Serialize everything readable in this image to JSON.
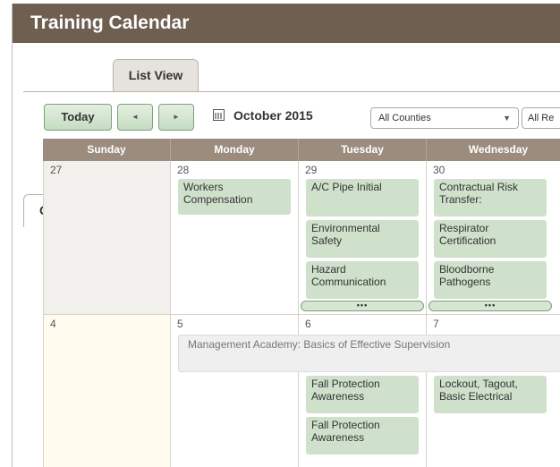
{
  "app": {
    "title": "Training Calendar"
  },
  "tabs": [
    {
      "label": "Calendar"
    },
    {
      "label": "List View"
    }
  ],
  "toolbar": {
    "today_label": "Today",
    "prev_label": "◄",
    "next_label": "►",
    "month_label": "October 2015",
    "county_filter": "All Counties",
    "region_filter": "All Re"
  },
  "calendar": {
    "weekday_headers": [
      "Sunday",
      "Monday",
      "Tuesday",
      "Wednesday"
    ],
    "weeks": [
      {
        "days": [
          {
            "num": "27",
            "events": []
          },
          {
            "num": "28",
            "events": [
              "Workers Compensation"
            ]
          },
          {
            "num": "29",
            "events": [
              "A/C Pipe Initial",
              "Environmental Safety",
              "Hazard Communication"
            ],
            "more": "•••"
          },
          {
            "num": "30",
            "events": [
              "Contractual Risk Transfer:",
              "Respirator Certification",
              "Bloodborne Pathogens"
            ],
            "more": "•••"
          }
        ]
      },
      {
        "spanning_event": "Management Academy: Basics of Effective Supervision",
        "days": [
          {
            "num": "4",
            "events": []
          },
          {
            "num": "5",
            "events": []
          },
          {
            "num": "6",
            "events": [
              "Fall Protection Awareness",
              "Fall Protection Awareness"
            ]
          },
          {
            "num": "7",
            "events": [
              "Lockout, Tagout, Basic Electrical"
            ]
          }
        ]
      }
    ]
  },
  "colors": {
    "title_bar": "#6e5f51",
    "header_bg": "#9b8c7d",
    "event_bg": "#cfe0cb",
    "past_day_bg": "#f2f0ed",
    "today_bg": "#fffbee"
  }
}
